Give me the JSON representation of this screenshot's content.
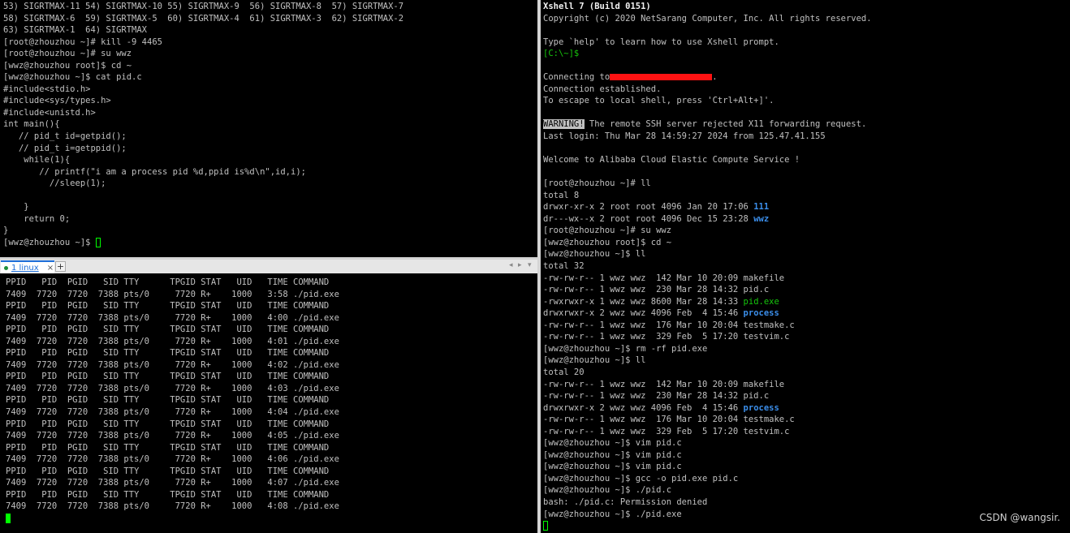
{
  "colors": {
    "background": "#000000",
    "text": "#c0c0c0",
    "bright_white": "#f2f2f2",
    "green": "#16c60c",
    "blue_dir": "#3b8eea",
    "splitter": "#d4d4d4",
    "tab_accent": "#1e6fd9",
    "cursor": "#00ff00",
    "redaction": "#ff1212"
  },
  "tabbar": {
    "tab_label": "1 linux",
    "close_label": "×",
    "add_label": "+",
    "prev_label": "◂",
    "next_label": "▸",
    "list_label": "▾"
  },
  "top_left": {
    "lines": [
      [
        {
          "t": "53) SIGRTMAX-11 54) SIGRTMAX-10 55) SIGRTMAX-9  56) SIGRTMAX-8  57) SIGRTMAX-7"
        }
      ],
      [
        {
          "t": "58) SIGRTMAX-6  59) SIGRTMAX-5  60) SIGRTMAX-4  61) SIGRTMAX-3  62) SIGRTMAX-2"
        }
      ],
      [
        {
          "t": "63) SIGRTMAX-1  64) SIGRTMAX"
        }
      ],
      [
        {
          "t": "[root@zhouzhou ~]# kill -9 4465"
        }
      ],
      [
        {
          "t": "[root@zhouzhou ~]# su wwz"
        }
      ],
      [
        {
          "t": "[wwz@zhouzhou root]$ cd ~"
        }
      ],
      [
        {
          "t": "[wwz@zhouzhou ~]$ cat pid.c"
        }
      ],
      [
        {
          "t": "#include<stdio.h>"
        }
      ],
      [
        {
          "t": "#include<sys/types.h>"
        }
      ],
      [
        {
          "t": "#include<unistd.h>"
        }
      ],
      [
        {
          "t": "int main(){"
        }
      ],
      [
        {
          "t": "   // pid_t id=getpid();"
        }
      ],
      [
        {
          "t": "   // pid_t i=getppid();"
        }
      ],
      [
        {
          "t": "    while(1){"
        }
      ],
      [
        {
          "t": "       // printf(\"i am a process pid %d,ppid is%d\\n\",id,i);"
        }
      ],
      [
        {
          "t": "         //sleep(1);"
        }
      ],
      [
        {
          "t": ""
        }
      ],
      [
        {
          "t": "    }"
        }
      ],
      [
        {
          "t": "    return 0;"
        }
      ],
      [
        {
          "t": "}"
        }
      ],
      [
        {
          "t": "[wwz@zhouzhou ~]$ "
        },
        {
          "t": "",
          "s": "cursor-hollow"
        }
      ]
    ]
  },
  "bottom_left": {
    "lines": [
      [
        {
          "t": "PPID   PID  PGID   SID TTY      TPGID STAT   UID   TIME COMMAND"
        }
      ],
      [
        {
          "t": "7409  7720  7720  7388 pts/0     7720 R+    1000   3:58 ./pid.exe"
        }
      ],
      [
        {
          "t": "PPID   PID  PGID   SID TTY      TPGID STAT   UID   TIME COMMAND"
        }
      ],
      [
        {
          "t": "7409  7720  7720  7388 pts/0     7720 R+    1000   4:00 ./pid.exe"
        }
      ],
      [
        {
          "t": "PPID   PID  PGID   SID TTY      TPGID STAT   UID   TIME COMMAND"
        }
      ],
      [
        {
          "t": "7409  7720  7720  7388 pts/0     7720 R+    1000   4:01 ./pid.exe"
        }
      ],
      [
        {
          "t": "PPID   PID  PGID   SID TTY      TPGID STAT   UID   TIME COMMAND"
        }
      ],
      [
        {
          "t": "7409  7720  7720  7388 pts/0     7720 R+    1000   4:02 ./pid.exe"
        }
      ],
      [
        {
          "t": "PPID   PID  PGID   SID TTY      TPGID STAT   UID   TIME COMMAND"
        }
      ],
      [
        {
          "t": "7409  7720  7720  7388 pts/0     7720 R+    1000   4:03 ./pid.exe"
        }
      ],
      [
        {
          "t": "PPID   PID  PGID   SID TTY      TPGID STAT   UID   TIME COMMAND"
        }
      ],
      [
        {
          "t": "7409  7720  7720  7388 pts/0     7720 R+    1000   4:04 ./pid.exe"
        }
      ],
      [
        {
          "t": "PPID   PID  PGID   SID TTY      TPGID STAT   UID   TIME COMMAND"
        }
      ],
      [
        {
          "t": "7409  7720  7720  7388 pts/0     7720 R+    1000   4:05 ./pid.exe"
        }
      ],
      [
        {
          "t": "PPID   PID  PGID   SID TTY      TPGID STAT   UID   TIME COMMAND"
        }
      ],
      [
        {
          "t": "7409  7720  7720  7388 pts/0     7720 R+    1000   4:06 ./pid.exe"
        }
      ],
      [
        {
          "t": "PPID   PID  PGID   SID TTY      TPGID STAT   UID   TIME COMMAND"
        }
      ],
      [
        {
          "t": "7409  7720  7720  7388 pts/0     7720 R+    1000   4:07 ./pid.exe"
        }
      ],
      [
        {
          "t": "PPID   PID  PGID   SID TTY      TPGID STAT   UID   TIME COMMAND"
        }
      ],
      [
        {
          "t": "7409  7720  7720  7388 pts/0     7720 R+    1000   4:08 ./pid.exe"
        }
      ],
      [
        {
          "t": "",
          "s": "cursor-solid"
        }
      ]
    ]
  },
  "right": {
    "lines": [
      [
        {
          "t": "Xshell 7 (Build 0151)",
          "s": "bold"
        }
      ],
      [
        {
          "t": "Copyright (c) 2020 NetSarang Computer, Inc. All rights reserved."
        }
      ],
      [
        {
          "t": ""
        }
      ],
      [
        {
          "t": "Type `help' to learn how to use Xshell prompt."
        }
      ],
      [
        {
          "t": "[C:\\~]$",
          "s": "green"
        }
      ],
      [
        {
          "t": ""
        }
      ],
      [
        {
          "t": "Connecting to"
        },
        {
          "t": "",
          "s": "redact"
        },
        {
          "t": "."
        }
      ],
      [
        {
          "t": "Connection established."
        }
      ],
      [
        {
          "t": "To escape to local shell, press 'Ctrl+Alt+]'."
        }
      ],
      [
        {
          "t": ""
        }
      ],
      [
        {
          "t": "WARNING!",
          "s": "inverse"
        },
        {
          "t": " The remote SSH server rejected X11 forwarding request."
        }
      ],
      [
        {
          "t": "Last login: Thu Mar 28 14:59:27 2024 from 125.47.41.155"
        }
      ],
      [
        {
          "t": ""
        }
      ],
      [
        {
          "t": "Welcome to Alibaba Cloud Elastic Compute Service !"
        }
      ],
      [
        {
          "t": ""
        }
      ],
      [
        {
          "t": "[root@zhouzhou ~]# ll"
        }
      ],
      [
        {
          "t": "total 8"
        }
      ],
      [
        {
          "t": "drwxr-xr-x 2 root root 4096 Jan 20 17:06 "
        },
        {
          "t": "111",
          "s": "blue"
        }
      ],
      [
        {
          "t": "dr---wx--x 2 root root 4096 Dec 15 23:28 "
        },
        {
          "t": "wwz",
          "s": "blue"
        }
      ],
      [
        {
          "t": "[root@zhouzhou ~]# su wwz"
        }
      ],
      [
        {
          "t": "[wwz@zhouzhou root]$ cd ~"
        }
      ],
      [
        {
          "t": "[wwz@zhouzhou ~]$ ll"
        }
      ],
      [
        {
          "t": "total 32"
        }
      ],
      [
        {
          "t": "-rw-rw-r-- 1 wwz wwz  142 Mar 10 20:09 makefile"
        }
      ],
      [
        {
          "t": "-rw-rw-r-- 1 wwz wwz  230 Mar 28 14:32 pid.c"
        }
      ],
      [
        {
          "t": "-rwxrwxr-x 1 wwz wwz 8600 Mar 28 14:33 "
        },
        {
          "t": "pid.exe",
          "s": "green"
        }
      ],
      [
        {
          "t": "drwxrwxr-x 2 wwz wwz 4096 Feb  4 15:46 "
        },
        {
          "t": "process",
          "s": "blue"
        }
      ],
      [
        {
          "t": "-rw-rw-r-- 1 wwz wwz  176 Mar 10 20:04 testmake.c"
        }
      ],
      [
        {
          "t": "-rw-rw-r-- 1 wwz wwz  329 Feb  5 17:20 testvim.c"
        }
      ],
      [
        {
          "t": "[wwz@zhouzhou ~]$ rm -rf pid.exe"
        }
      ],
      [
        {
          "t": "[wwz@zhouzhou ~]$ ll"
        }
      ],
      [
        {
          "t": "total 20"
        }
      ],
      [
        {
          "t": "-rw-rw-r-- 1 wwz wwz  142 Mar 10 20:09 makefile"
        }
      ],
      [
        {
          "t": "-rw-rw-r-- 1 wwz wwz  230 Mar 28 14:32 pid.c"
        }
      ],
      [
        {
          "t": "drwxrwxr-x 2 wwz wwz 4096 Feb  4 15:46 "
        },
        {
          "t": "process",
          "s": "blue"
        }
      ],
      [
        {
          "t": "-rw-rw-r-- 1 wwz wwz  176 Mar 10 20:04 testmake.c"
        }
      ],
      [
        {
          "t": "-rw-rw-r-- 1 wwz wwz  329 Feb  5 17:20 testvim.c"
        }
      ],
      [
        {
          "t": "[wwz@zhouzhou ~]$ vim pid.c"
        }
      ],
      [
        {
          "t": "[wwz@zhouzhou ~]$ vim pid.c"
        }
      ],
      [
        {
          "t": "[wwz@zhouzhou ~]$ vim pid.c"
        }
      ],
      [
        {
          "t": "[wwz@zhouzhou ~]$ gcc -o pid.exe pid.c"
        }
      ],
      [
        {
          "t": "[wwz@zhouzhou ~]$ ./pid.c"
        }
      ],
      [
        {
          "t": "bash: ./pid.c: Permission denied"
        }
      ],
      [
        {
          "t": "[wwz@zhouzhou ~]$ ./pid.exe"
        }
      ],
      [
        {
          "t": "",
          "s": "cursor-hollow"
        }
      ]
    ]
  },
  "watermark": "CSDN @wangsir."
}
